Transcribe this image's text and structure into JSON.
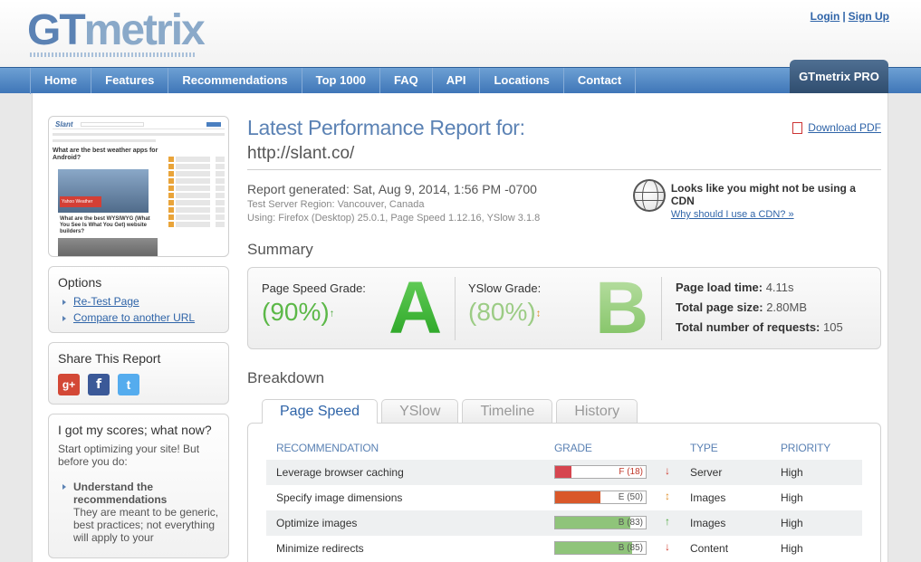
{
  "header": {
    "logo_gt": "GT",
    "logo_metrix": "metrix",
    "login": "Login",
    "signup": "Sign Up",
    "separator": "|"
  },
  "nav": {
    "items": [
      "Home",
      "Features",
      "Recommendations",
      "Top 1000",
      "FAQ",
      "API",
      "Locations",
      "Contact"
    ],
    "pro": "GTmetrix PRO"
  },
  "sidebar": {
    "thumb": {
      "logo": "Slant",
      "title": "What are the best weather apps for Android?",
      "badge": "Yahoo Weather",
      "title2": "What are the best WYSIWYG (What You See Is What You Get) website builders?"
    },
    "options": {
      "title": "Options",
      "links": [
        "Re-Test Page",
        "Compare to another URL"
      ]
    },
    "share": {
      "title": "Share This Report",
      "icons": [
        "g+",
        "f",
        "t"
      ]
    },
    "scores": {
      "title": "I got my scores; what now?",
      "intro": "Start optimizing your site! But before you do:",
      "bullet": "Understand the recommendations",
      "desc": "They are meant to be generic, best practices; not everything will apply to your"
    }
  },
  "report": {
    "title": "Latest Performance Report for:",
    "url": "http://slant.co/",
    "download": "Download PDF",
    "generated": "Report generated: Sat, Aug 9, 2014, 1:56 PM -0700",
    "server": "Test Server Region: Vancouver, Canada",
    "using": "Using: Firefox (Desktop) 25.0.1, Page Speed 1.12.16, YSlow 3.1.8",
    "cdn_title": "Looks like you might not be using a CDN",
    "cdn_link": "Why should I use a CDN? »"
  },
  "summary": {
    "heading": "Summary",
    "pagespeed_label": "Page Speed Grade:",
    "pagespeed_pct": "(90%)",
    "pagespeed_arrow": "↑",
    "pagespeed_letter": "A",
    "yslow_label": "YSlow Grade:",
    "yslow_pct": "(80%)",
    "yslow_arrow": "↕",
    "yslow_letter": "B",
    "load_label": "Page load time:",
    "load_value": "4.11s",
    "size_label": "Total page size:",
    "size_value": "2.80MB",
    "requests_label": "Total number of requests:",
    "requests_value": "105"
  },
  "breakdown": {
    "heading": "Breakdown",
    "tabs": [
      "Page Speed",
      "YSlow",
      "Timeline",
      "History"
    ],
    "columns": [
      "RECOMMENDATION",
      "GRADE",
      "TYPE",
      "PRIORITY"
    ],
    "rows": [
      {
        "name": "Leverage browser caching",
        "grade": "F (18)",
        "score": 18,
        "color": "#d6454f",
        "text_color": "#c0392b",
        "arrow": "↓",
        "arrow_color": "#d03a2f",
        "type": "Server",
        "priority": "High"
      },
      {
        "name": "Specify image dimensions",
        "grade": "E (50)",
        "score": 50,
        "color": "#d9582a",
        "text_color": "#555555",
        "arrow": "↕",
        "arrow_color": "#e0912d",
        "type": "Images",
        "priority": "High"
      },
      {
        "name": "Optimize images",
        "grade": "B (83)",
        "score": 83,
        "color": "#8fc47a",
        "text_color": "#555555",
        "arrow": "↑",
        "arrow_color": "#4aa83a",
        "type": "Images",
        "priority": "High"
      },
      {
        "name": "Minimize redirects",
        "grade": "B (85)",
        "score": 85,
        "color": "#8fc47a",
        "text_color": "#555555",
        "arrow": "↓",
        "arrow_color": "#d03a2f",
        "type": "Content",
        "priority": "High"
      }
    ]
  }
}
